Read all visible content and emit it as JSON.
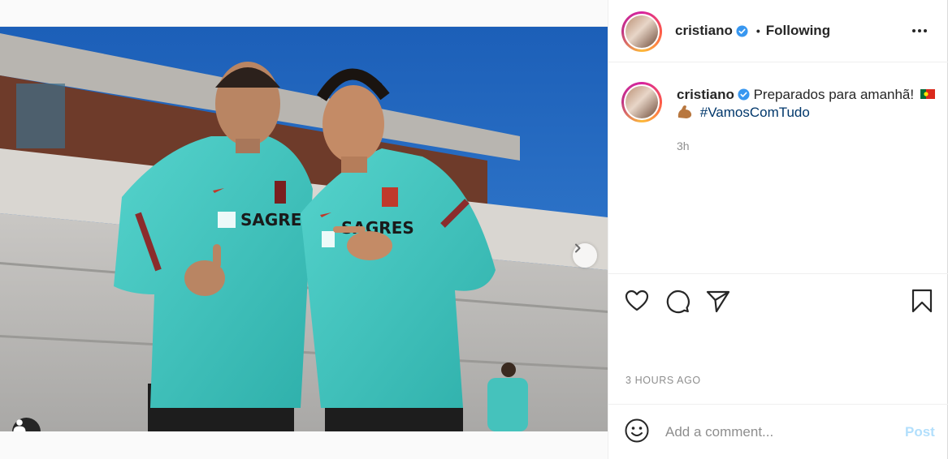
{
  "post": {
    "author": "cristiano",
    "follow_separator": "•",
    "follow_status": "Following",
    "caption_text": "Preparados para amanhã!",
    "caption_flag": "portugal-flag",
    "caption_emoji": "flexed-biceps",
    "hashtag": "#VamosComTudo",
    "caption_time": "3h",
    "posted_ago": "3 HOURS AGO",
    "image_count": 2,
    "current_image": 1
  },
  "comment": {
    "placeholder": "Add a comment...",
    "post_label": "Post"
  },
  "icons": {
    "more": "more-options-icon",
    "verified": "verified-badge-icon",
    "like": "heart-icon",
    "comment": "comment-icon",
    "share": "paper-plane-icon",
    "save": "bookmark-icon",
    "emoji": "smiley-icon",
    "next": "chevron-right-icon",
    "tag": "user-tag-icon"
  },
  "colors": {
    "verified_blue": "#3897f0",
    "hashtag": "#00376b",
    "post_disabled": "#b2dffc",
    "secondary_text": "#8e8e8e",
    "jersey_teal": "#3cc4bf"
  }
}
